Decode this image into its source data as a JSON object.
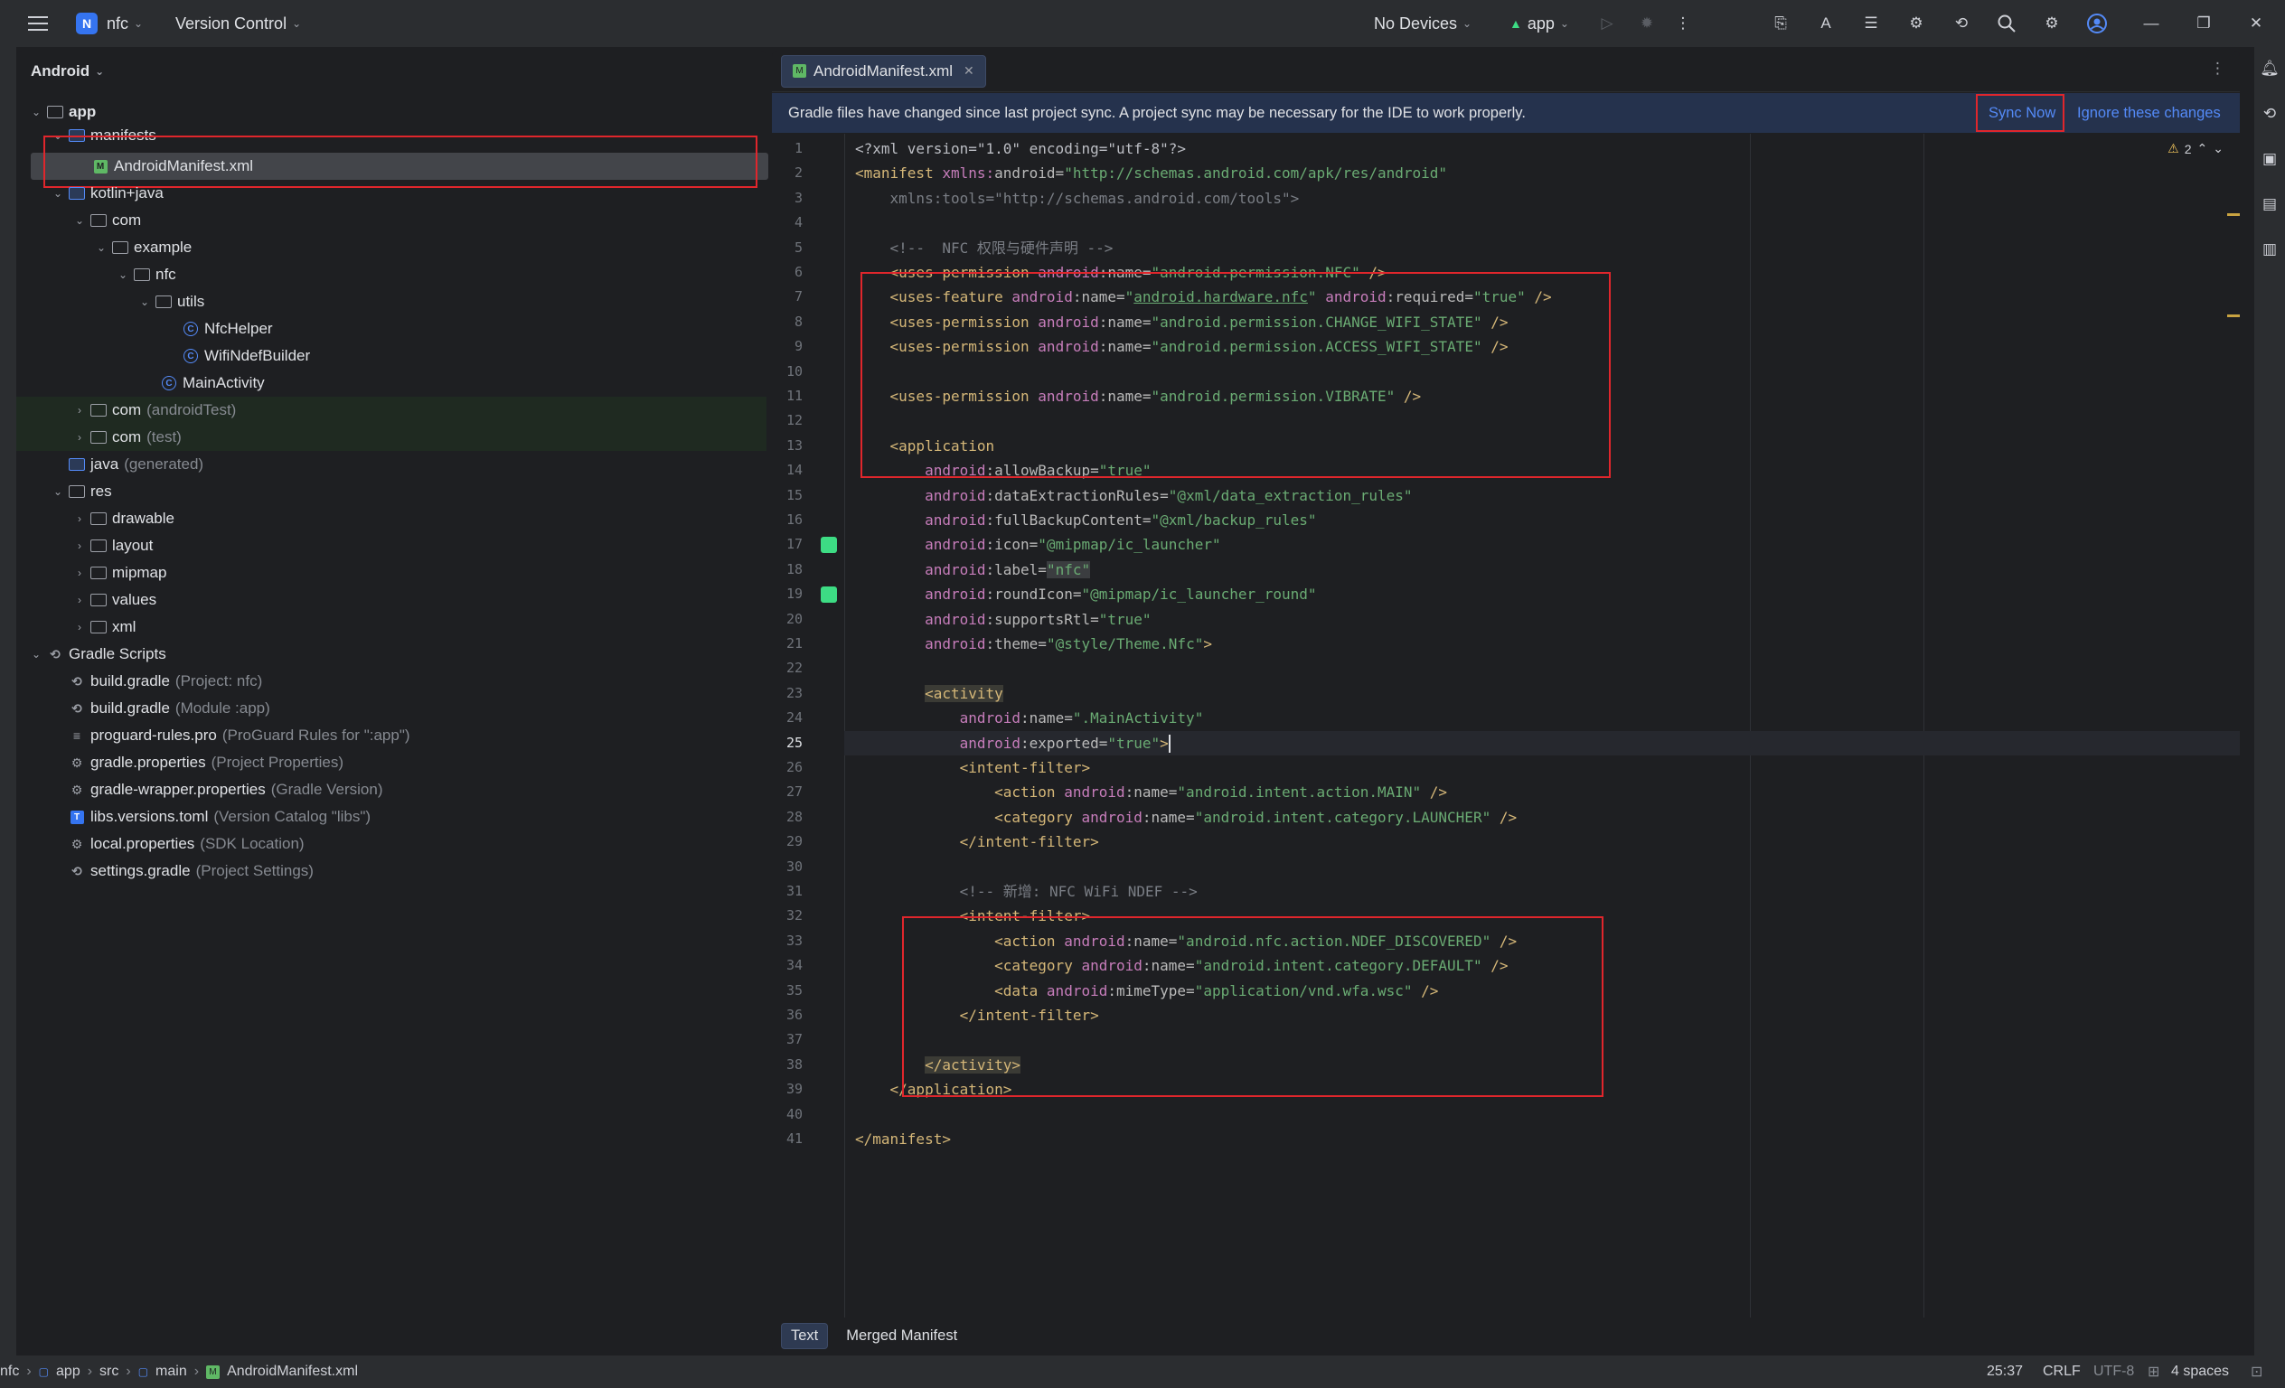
{
  "titlebar": {
    "project_badge": "N",
    "project_name": "nfc",
    "vcs_label": "Version Control",
    "devices_label": "No Devices",
    "run_config": "app"
  },
  "project_panel": {
    "view_label": "Android",
    "tree": [
      {
        "label": "app",
        "bold": true
      },
      {
        "label": "manifests"
      },
      {
        "label": "AndroidManifest.xml"
      },
      {
        "label": "kotlin+java"
      },
      {
        "label": "com"
      },
      {
        "label": "example"
      },
      {
        "label": "nfc"
      },
      {
        "label": "utils"
      },
      {
        "label": "NfcHelper"
      },
      {
        "label": "WifiNdefBuilder"
      },
      {
        "label": "MainActivity"
      },
      {
        "label": "com",
        "hint": "(androidTest)"
      },
      {
        "label": "com",
        "hint": "(test)"
      },
      {
        "label": "java",
        "hint": "(generated)"
      },
      {
        "label": "res"
      },
      {
        "label": "drawable"
      },
      {
        "label": "layout"
      },
      {
        "label": "mipmap"
      },
      {
        "label": "values"
      },
      {
        "label": "xml"
      },
      {
        "label": "Gradle Scripts"
      },
      {
        "label": "build.gradle",
        "hint": "(Project: nfc)"
      },
      {
        "label": "build.gradle",
        "hint": "(Module :app)"
      },
      {
        "label": "proguard-rules.pro",
        "hint": "(ProGuard Rules for \":app\")"
      },
      {
        "label": "gradle.properties",
        "hint": "(Project Properties)"
      },
      {
        "label": "gradle-wrapper.properties",
        "hint": "(Gradle Version)"
      },
      {
        "label": "libs.versions.toml",
        "hint": "(Version Catalog \"libs\")"
      },
      {
        "label": "local.properties",
        "hint": "(SDK Location)"
      },
      {
        "label": "settings.gradle",
        "hint": "(Project Settings)"
      }
    ]
  },
  "editor": {
    "tab_label": "AndroidManifest.xml",
    "banner_text": "Gradle files have changed since last project sync. A project sync may be necessary for the IDE to work properly.",
    "sync_now": "Sync Now",
    "ignore_changes": "Ignore these changes",
    "warning_count": "2",
    "current_line": "25",
    "bottom_tabs": [
      "Text",
      "Merged Manifest"
    ]
  },
  "code_lines": [
    "1",
    "2",
    "3",
    "4",
    "5",
    "6",
    "7",
    "8",
    "9",
    "10",
    "11",
    "12",
    "13",
    "14",
    "15",
    "16",
    "17",
    "18",
    "19",
    "20",
    "21",
    "22",
    "23",
    "24",
    "25",
    "26",
    "27",
    "28",
    "29",
    "30",
    "31",
    "32",
    "33",
    "34",
    "35",
    "36",
    "37",
    "38",
    "39",
    "40",
    "41"
  ],
  "code": {
    "l1": "<?xml version=\"1.0\" encoding=\"utf-8\"?>",
    "l2_tag": "<manifest ",
    "l2_attr": "xmlns:android=",
    "l2_val": "\"http://schemas.android.com/apk/res/android\"",
    "l3": "    xmlns:tools=\"http://schemas.android.com/tools\">",
    "l5": "    <!--  NFC 权限与硬件声明 -->",
    "l6_val": "\"android.permission.NFC\"",
    "l7_val": "android.hardware.nfc",
    "l7_val2": "\"true\"",
    "l8_val": "\"android.permission.CHANGE_WIFI_STATE\"",
    "l9_val": "\"android.permission.ACCESS_WIFI_STATE\"",
    "l11_val": "\"android.permission.VIBRATE\"",
    "l13": "<application",
    "l14_val": "\"true\"",
    "l15_val": "\"@xml/data_extraction_rules\"",
    "l16_val": "\"@xml/backup_rules\"",
    "l17_val": "\"@mipmap/ic_launcher\"",
    "l18_val": "\"nfc\"",
    "l19_val": "\"@mipmap/ic_launcher_round\"",
    "l20_val": "\"true\"",
    "l21_val": "\"@style/Theme.Nfc\"",
    "l23": "<activity",
    "l24_val": "\".MainActivity\"",
    "l25_val": "\"true\"",
    "l27_val": "\"android.intent.action.MAIN\"",
    "l28_val": "\"android.intent.category.LAUNCHER\"",
    "l31": "<!-- 新增: NFC WiFi NDEF -->",
    "l33_val": "\"android.nfc.action.NDEF_DISCOVERED\"",
    "l34_val": "\"android.intent.category.DEFAULT\"",
    "l35_val": "\"application/vnd.wfa.wsc\"",
    "l38": "</activity>",
    "l39": "</application>",
    "l41": "</manifest>"
  },
  "status_bar": {
    "breadcrumb": [
      "nfc",
      "app",
      "src",
      "main",
      "AndroidManifest.xml"
    ],
    "position": "25:37",
    "line_sep": "CRLF",
    "encoding": "UTF-8",
    "indent": "4 spaces"
  }
}
